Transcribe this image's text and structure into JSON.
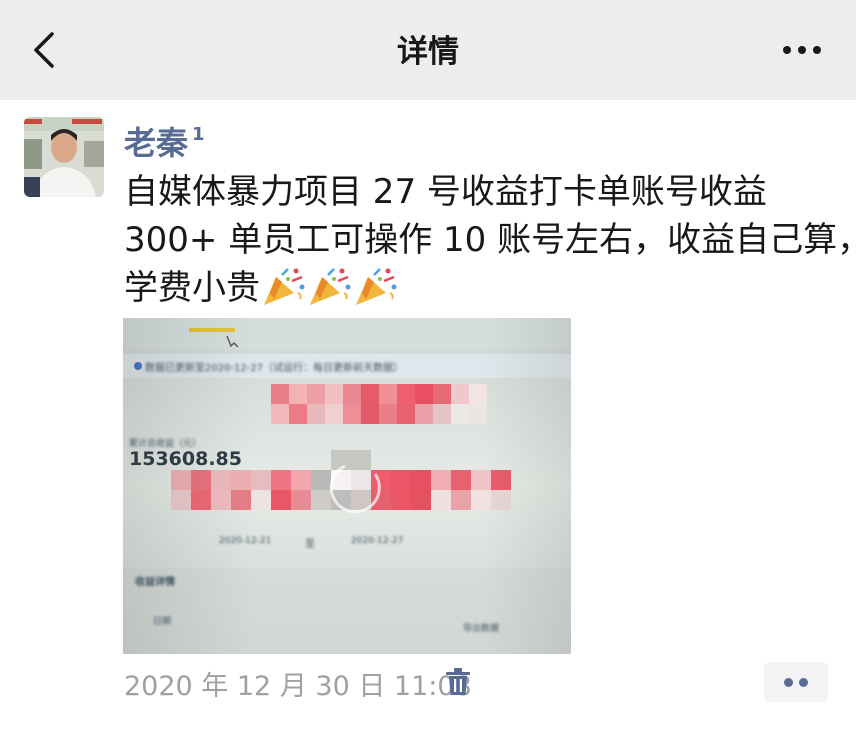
{
  "nav": {
    "title": "详情",
    "back_icon": "chevron-left-icon",
    "more_icon": "more-horizontal-icon"
  },
  "post": {
    "author": "老秦",
    "author_badge": "1",
    "lines": [
      "自媒体暴力项目 27 号收益打卡单账号收益",
      "300+ 单员工可操作 10 账号左右，收益自己算，",
      "学费小贵"
    ],
    "emoji": "party-popper-icon",
    "emoji_count": 3,
    "photo": {
      "banner_text": "数据已更新至2020-12-27（试运行：每日更新前天数据）",
      "total_label": "累计总收益（元）",
      "total_value": "153608.85",
      "date_start": "2020-12-21",
      "date_sep": "至",
      "date_end": "2020-12-27",
      "section_label": "收益详情",
      "row_label": "日期",
      "export_label": "导出数据"
    },
    "timestamp": "2020 年 12 月 30 日  11:08"
  },
  "colors": {
    "nav_bg": "#ededed",
    "link": "#576b95",
    "meta": "#a0a0a0",
    "text": "#181818"
  }
}
